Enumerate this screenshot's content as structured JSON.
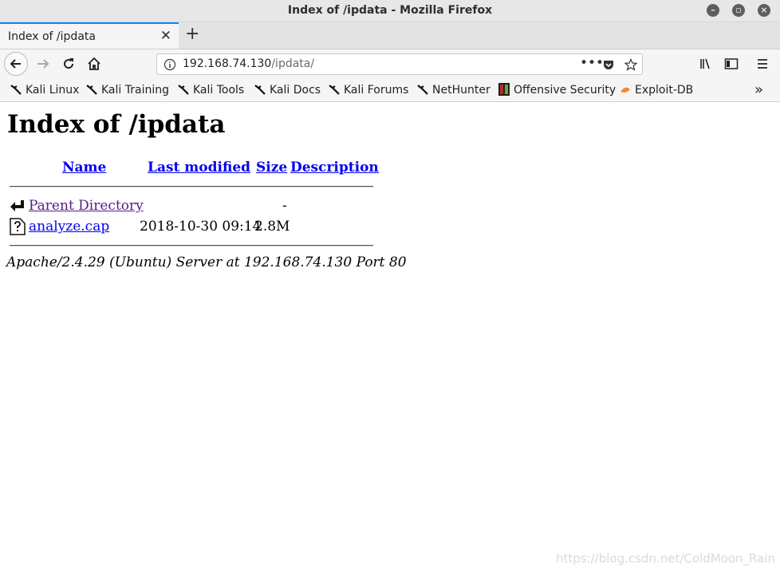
{
  "window": {
    "title": "Index of /ipdata - Mozilla Firefox"
  },
  "tabs": [
    {
      "label": "Index of /ipdata",
      "active": true
    }
  ],
  "navbar": {
    "url_host": "192.168.74.130",
    "url_path": "/ipdata/"
  },
  "bookmarks": [
    {
      "label": "Kali Linux",
      "icon": "kali-dragon-icon"
    },
    {
      "label": "Kali Training",
      "icon": "kali-dragon-icon"
    },
    {
      "label": "Kali Tools",
      "icon": "kali-dragon-icon"
    },
    {
      "label": "Kali Docs",
      "icon": "kali-dragon-icon"
    },
    {
      "label": "Kali Forums",
      "icon": "kali-dragon-icon"
    },
    {
      "label": "NetHunter",
      "icon": "kali-dragon-icon"
    },
    {
      "label": "Offensive Security",
      "icon": "offsec-icon"
    },
    {
      "label": "Exploit-DB",
      "icon": "exploitdb-icon"
    }
  ],
  "page": {
    "heading": "Index of /ipdata",
    "columns": {
      "name": "Name",
      "modified": "Last modified",
      "size": "Size",
      "description": "Description"
    },
    "rows": [
      {
        "name": "Parent Directory",
        "modified": "",
        "size": "-",
        "icon": "back-arrow-icon"
      },
      {
        "name": "analyze.cap",
        "modified": "2018-10-30 09:14",
        "size": "2.8M",
        "icon": "unknown-file-icon"
      }
    ],
    "footer": "Apache/2.4.29 (Ubuntu) Server at 192.168.74.130 Port 80"
  },
  "watermark": "https://blog.csdn.net/ColdMoon_Rain",
  "colors": {
    "link": "#0000ee",
    "visited": "#551a8b",
    "tab_accent": "#0a84ff"
  }
}
